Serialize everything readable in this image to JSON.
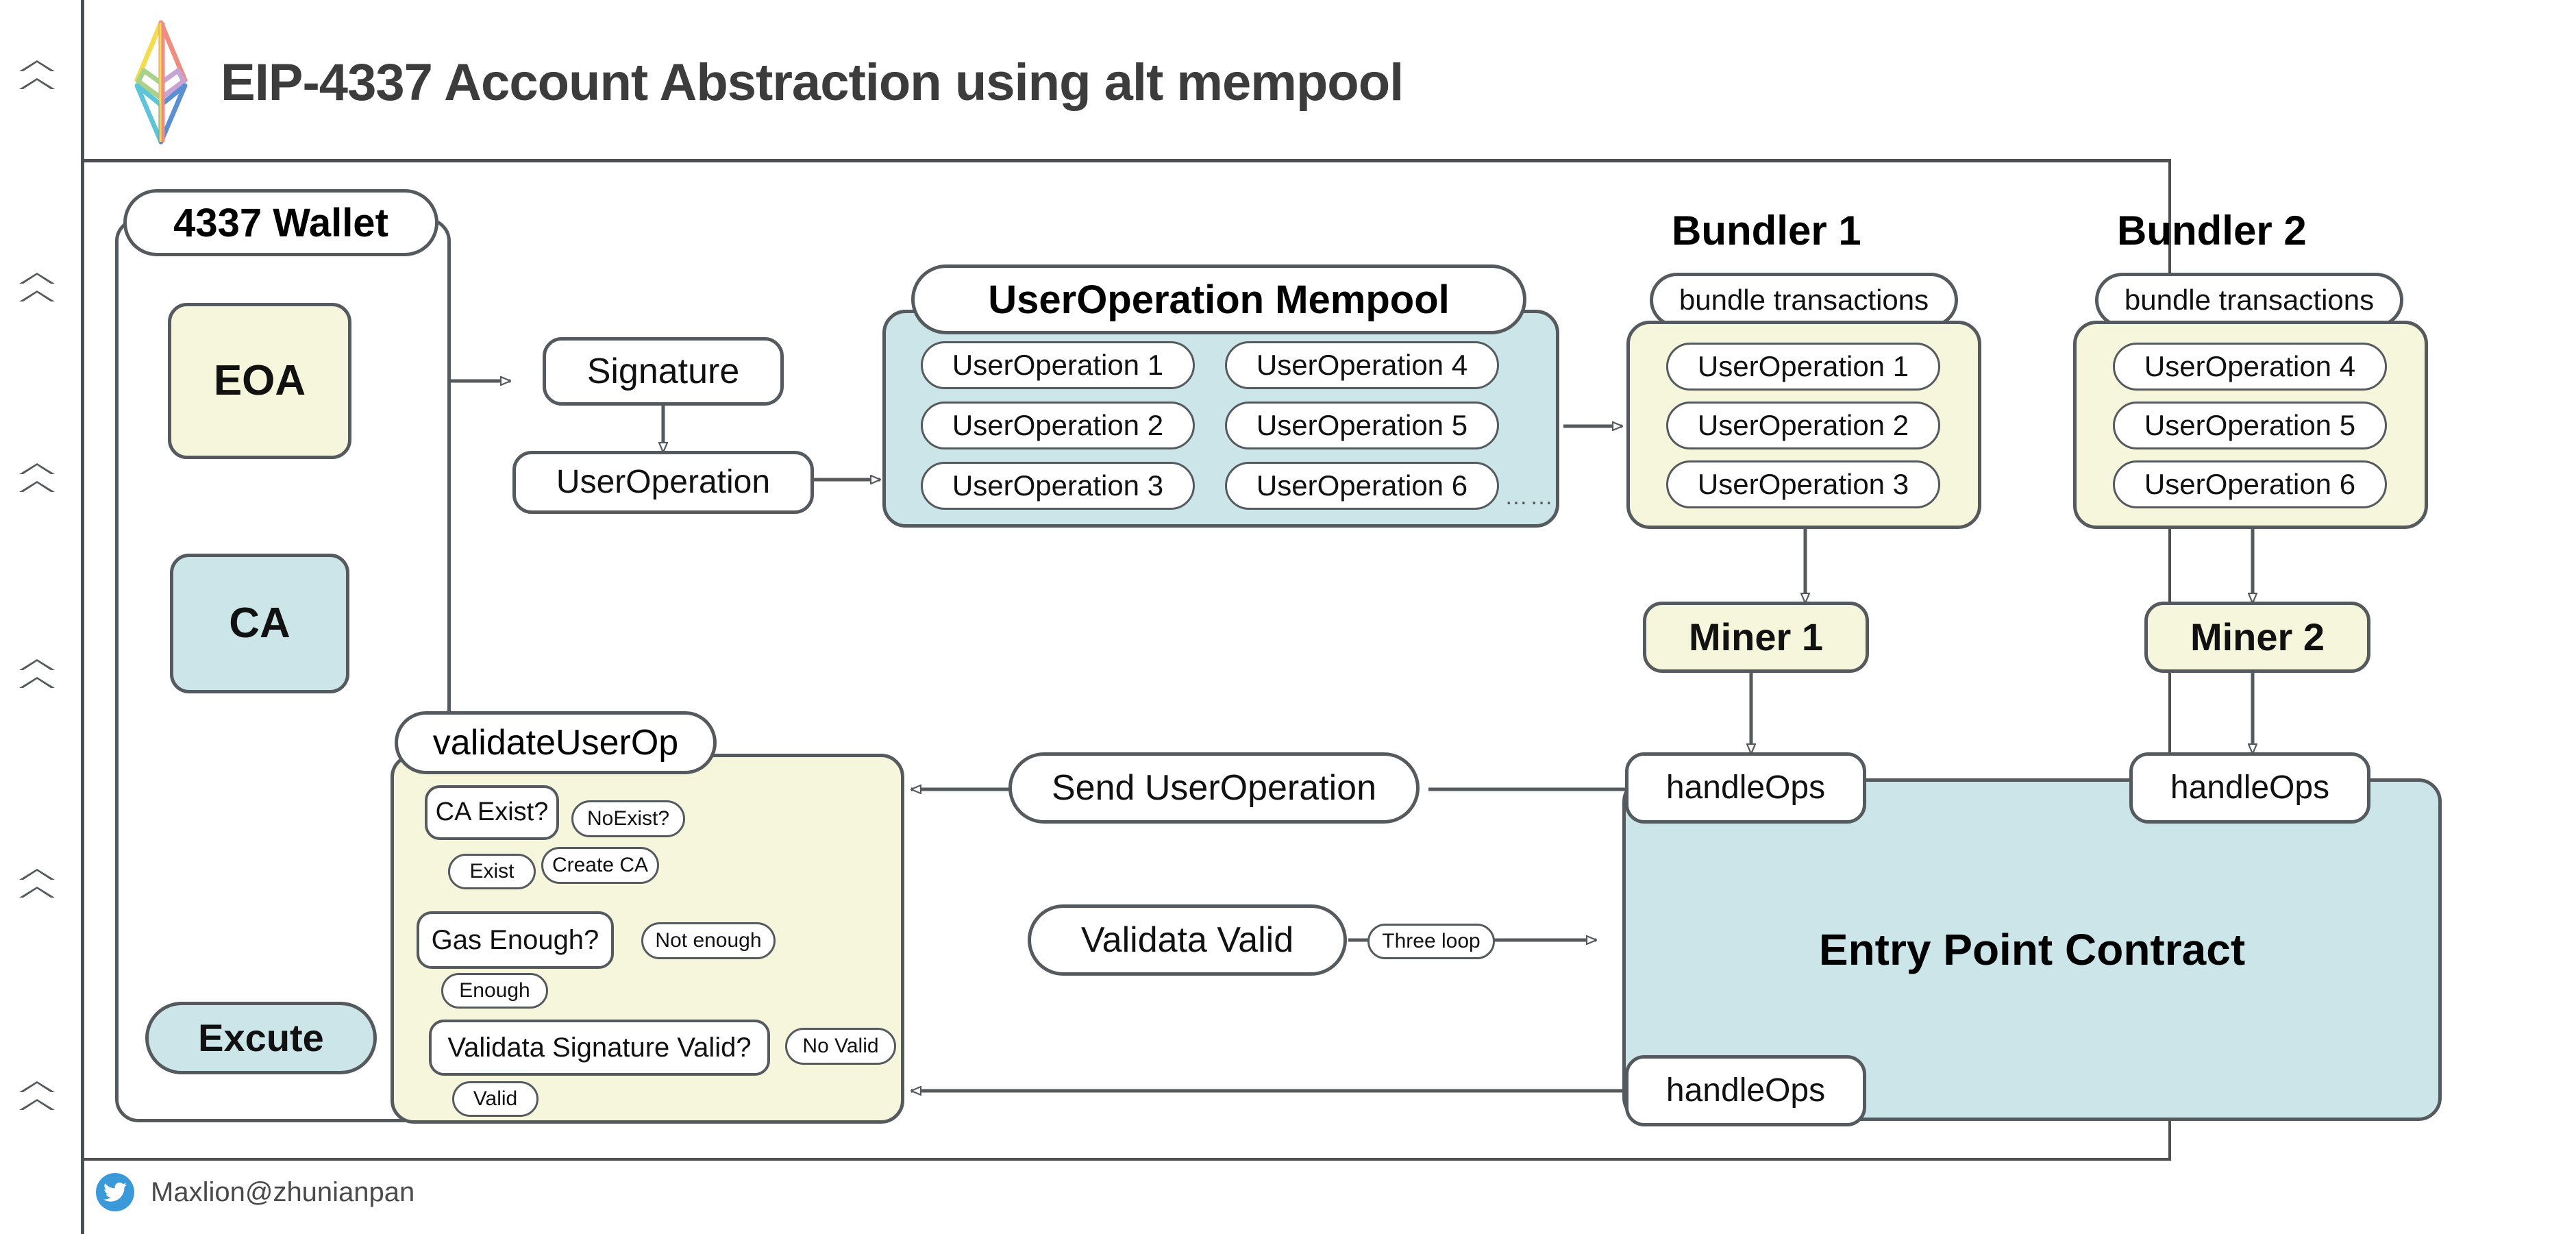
{
  "header": {
    "title": "EIP-4337 Account Abstraction using alt mempool",
    "logo_icon": "ethereum-logo-icon"
  },
  "footer": {
    "social_icon": "twitter-bird-icon",
    "handle": "Maxlion@zhunianpan"
  },
  "colors": {
    "yellow_fill": "#f6f6dc",
    "blue_fill": "#cbe5e9",
    "stroke": "#555a5e",
    "title_text": "#3c3c3c",
    "twitter_blue": "#3a9ad9"
  },
  "wallet": {
    "group_title": "4337 Wallet",
    "eoa": "EOA",
    "ca": "CA",
    "excute": "Excute"
  },
  "signature_flow": {
    "signature": "Signature",
    "user_operation": "UserOperation"
  },
  "mempool": {
    "group_title": "UserOperation Mempool",
    "column_left": [
      "UserOperation 1",
      "UserOperation 2",
      "UserOperation 3"
    ],
    "column_right": [
      "UserOperation 4",
      "UserOperation 5",
      "UserOperation 6"
    ],
    "ellipsis": "……"
  },
  "bundlers": [
    {
      "name": "Bundler 1",
      "subtitle": "bundle transactions",
      "ops": [
        "UserOperation 1",
        "UserOperation 2",
        "UserOperation 3"
      ],
      "miner": "Miner 1",
      "handle_ops": "handleOps"
    },
    {
      "name": "Bundler 2",
      "subtitle": "bundle transactions",
      "ops": [
        "UserOperation 4",
        "UserOperation 5",
        "UserOperation 6"
      ],
      "miner": "Miner 2",
      "handle_ops": "handleOps"
    }
  ],
  "entry_point": {
    "label": "Entry Point Contract",
    "handle_ops_bottom": "handleOps"
  },
  "connectors": {
    "send_user_operation": "Send UserOperation",
    "validata_valid": "Validata Valid",
    "three_loop": "Three loop"
  },
  "validate": {
    "group_title": "validateUserOp",
    "steps": [
      {
        "question": "CA Exist?",
        "no_branch": "NoExist?",
        "no_action": "Create CA",
        "yes_branch": "Exist"
      },
      {
        "question": "Gas Enough?",
        "no_branch": "Not enough",
        "no_action": "",
        "yes_branch": "Enough"
      },
      {
        "question": "Validata Signature Valid?",
        "no_branch": "No Valid",
        "no_action": "",
        "yes_branch": "Valid"
      }
    ]
  },
  "gutter": {
    "marker_icon": "triangle-marker-icon",
    "pair_count": 6
  }
}
